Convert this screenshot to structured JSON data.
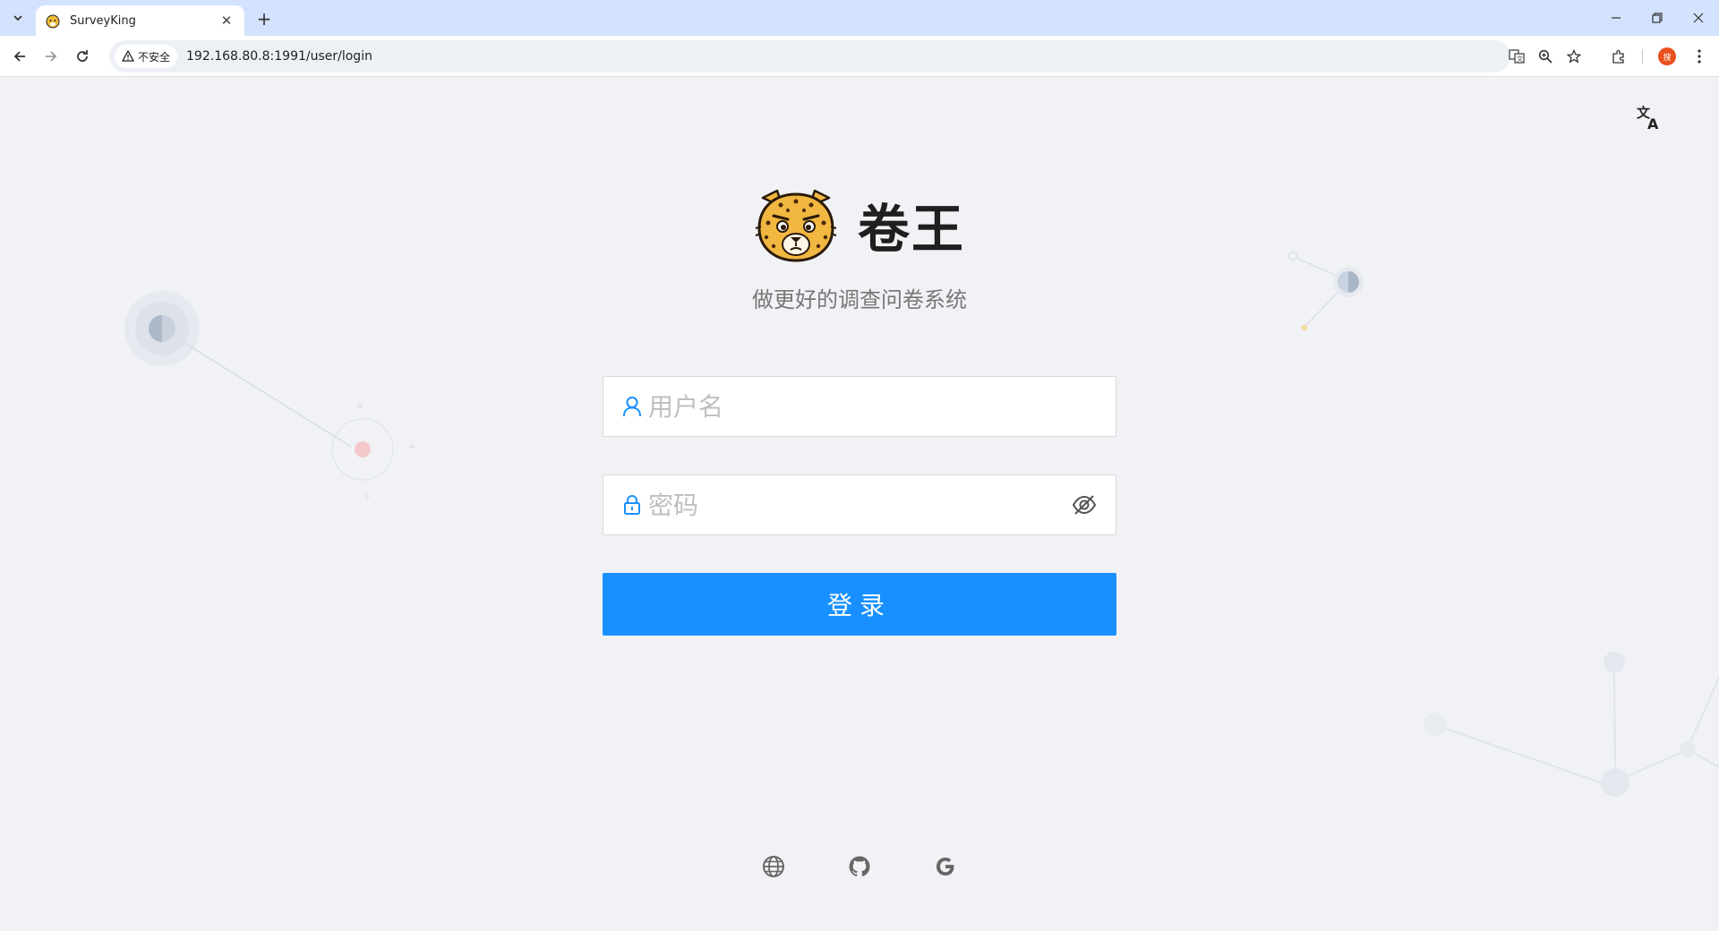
{
  "browser": {
    "tab_title": "SurveyKing",
    "security_label": "不安全",
    "url": "192.168.80.8:1991/user/login",
    "profile_initial": "搜"
  },
  "page": {
    "brand_title": "卷王",
    "subtitle": "做更好的调查问卷系统",
    "username_placeholder": "用户名",
    "password_placeholder": "密码",
    "login_label": "登录",
    "footer_icons": [
      "globe-icon",
      "github-icon",
      "google-icon"
    ],
    "accent_color": "#1890ff"
  }
}
